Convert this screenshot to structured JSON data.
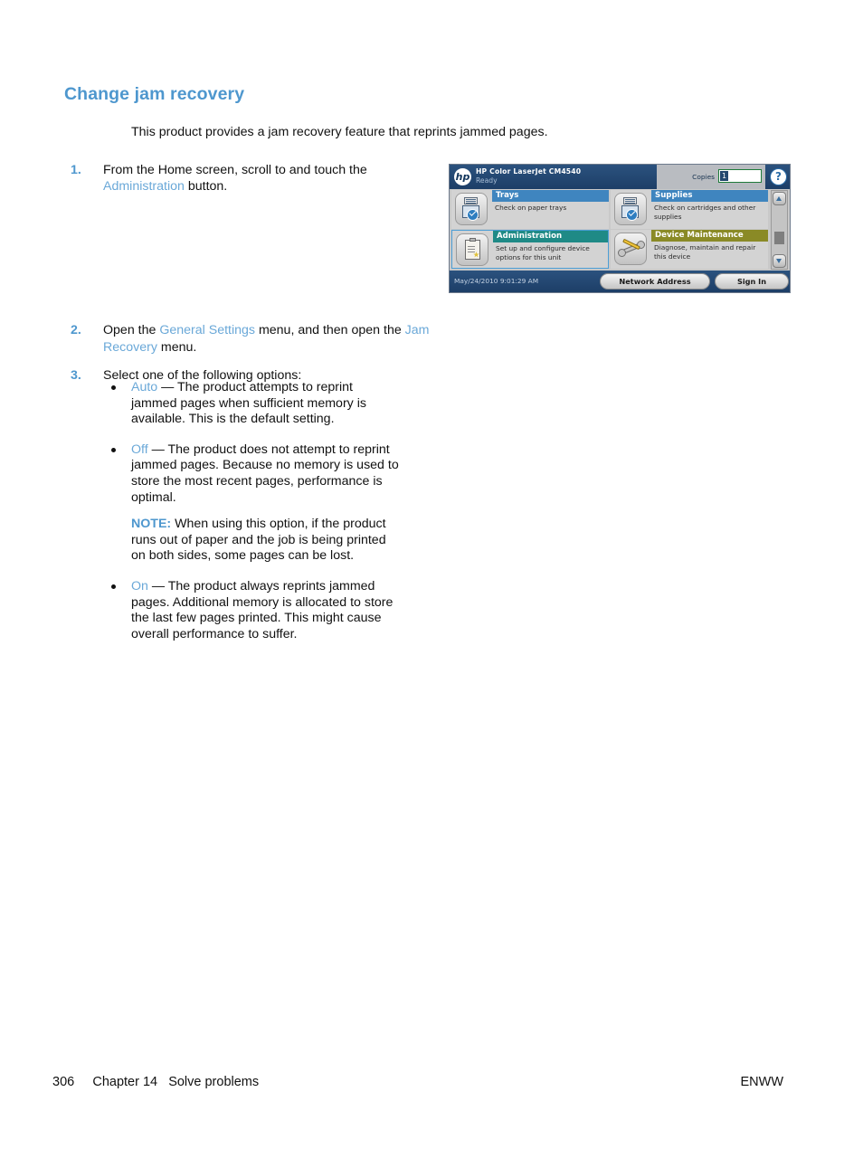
{
  "document": {
    "heading": "Change jam recovery",
    "intro": "This product provides a jam recovery feature that reprints jammed pages.",
    "steps": [
      {
        "number": "1.",
        "text_before": "From the Home screen, scroll to and touch the ",
        "highlight": "Administration",
        "text_after": " button."
      },
      {
        "number": "2.",
        "text_before": "Open the ",
        "highlight": "General Settings",
        "text_mid": " menu, and then open the ",
        "highlight2": "Jam Recovery",
        "text_after": " menu."
      },
      {
        "number": "3.",
        "text_before": "Select one of the following options:"
      }
    ],
    "bullets": [
      {
        "highlight": "Auto",
        "text": " — The product attempts to reprint jammed pages when sufficient memory is available. This is the default setting."
      },
      {
        "highlight": "Off",
        "text": " — The product does not attempt to reprint jammed pages. Because no memory is used to store the most recent pages, performance is optimal."
      },
      {
        "highlight": "On",
        "text": " — The product always reprints jammed pages. Additional memory is allocated to store the last few pages printed. This might cause overall performance to suffer."
      }
    ],
    "note": {
      "label": "NOTE:",
      "text": "   When using this option, if the product runs out of paper and the job is being printed on both sides, some pages can be lost."
    },
    "footer": {
      "page_number": "306",
      "chapter": "Chapter 14   Solve problems",
      "right": "ENWW"
    },
    "colors": {
      "heading_blue": "#4e97ce",
      "inline_blue": "#6aa8d8"
    }
  },
  "control_panel": {
    "title_bar": {
      "logo": "hp",
      "model": "HP Color LaserJet CM4540",
      "status": "Ready",
      "copies_label": "Copies",
      "copies_value": "1",
      "help_icon": "?"
    },
    "tiles": [
      {
        "title": "Trays",
        "subtitle": "Check on paper trays",
        "header_color": "#3f85bf",
        "icon": "printer-tray-icon",
        "selected": false
      },
      {
        "title": "Supplies",
        "subtitle": "Check on cartridges and other supplies",
        "header_color": "#3f85bf",
        "icon": "printer-supplies-icon",
        "selected": false
      },
      {
        "title": "Administration",
        "subtitle": "Set up and configure device options for this unit",
        "header_color": "#1f8a86",
        "icon": "clipboard-icon",
        "selected": true
      },
      {
        "title": "Device Maintenance",
        "subtitle": "Diagnose, maintain and repair this device",
        "header_color": "#8a8a26",
        "icon": "wrench-screwdriver-icon",
        "selected": false
      }
    ],
    "bottom_bar": {
      "datetime": "May/24/2010 9:01:29 AM",
      "network_button": "Network Address",
      "signin_button": "Sign In"
    }
  }
}
